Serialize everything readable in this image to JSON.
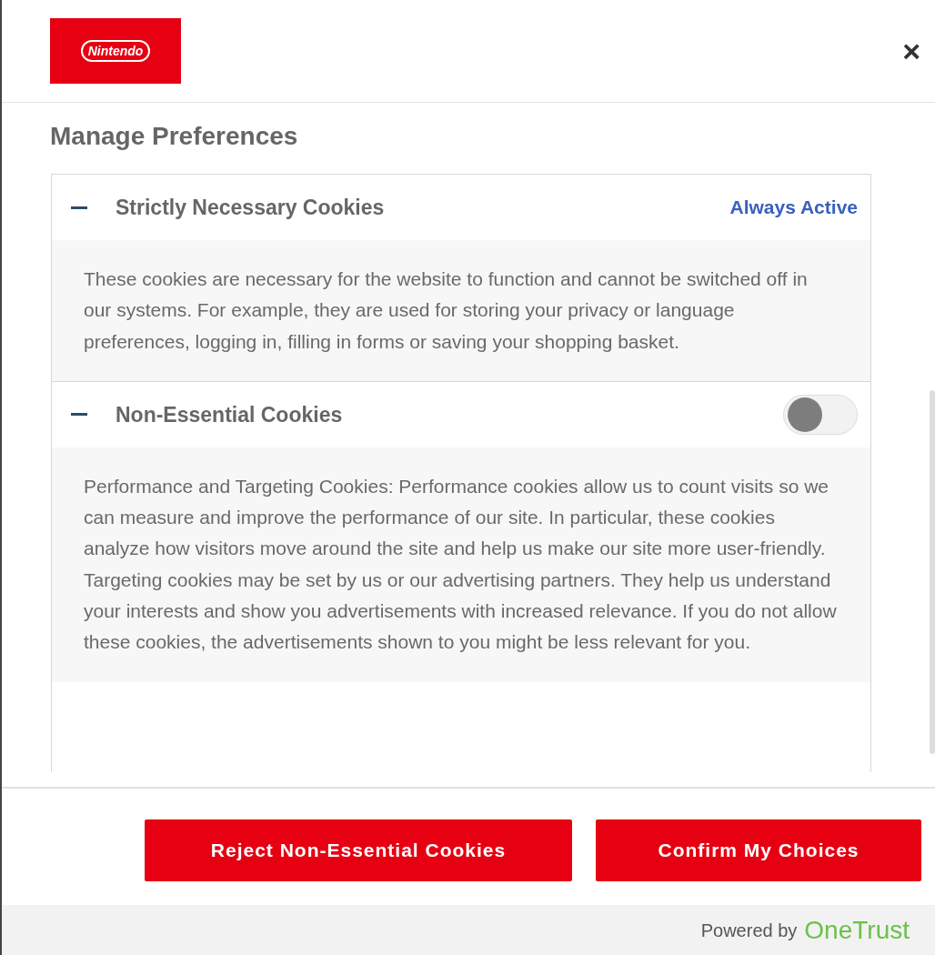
{
  "header": {
    "logo": "Nintendo",
    "close": "×"
  },
  "title": "Manage Preferences",
  "sections": [
    {
      "kind": "always-active",
      "title": "Strictly Necessary Cookies",
      "expanded": true,
      "status": "Always Active",
      "description": "These cookies are necessary for the website to function and cannot be switched off in our systems. For example, they are used for storing your privacy or language preferences, logging in, filling in forms or saving your shopping basket."
    },
    {
      "kind": "toggle",
      "title": "Non-Essential Cookies",
      "expanded": true,
      "on": false,
      "description": "Performance and Targeting Cookies: Performance cookies allow us to count visits so we can measure and improve the performance of our site. In particular, these cookies analyze how visitors move around the site and help us make our site more user-friendly. Targeting cookies may be set by us or our advertising partners. They help us understand your interests and show you advertisements with increased relevance. If you do not allow these cookies, the advertisements shown to you might be less relevant for you."
    }
  ],
  "buttons": [
    "Reject Non-Essential Cookies",
    "Confirm My Choices"
  ],
  "footer": {
    "powered_by": "Powered by",
    "brand": "OneTrust"
  }
}
